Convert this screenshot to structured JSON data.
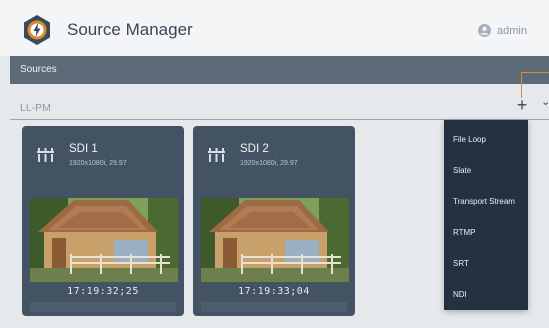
{
  "header": {
    "title": "Source Manager",
    "user": "admin",
    "logo_icon": "gear-lightning-logo-icon",
    "user_icon": "user-circle-icon"
  },
  "sources_bar": {
    "label": "Sources"
  },
  "group": {
    "name": "LL-PM",
    "add_label": "+",
    "add_icon": "plus-icon",
    "chevron_icon": "chevron-down-icon"
  },
  "cards": [
    {
      "name": "SDI 1",
      "format": "1920x1080i, 29.97",
      "timecode": "17:19:32;25",
      "icon": "sdi-connector-icon"
    },
    {
      "name": "SDI 2",
      "format": "1920x1080i, 29.97",
      "timecode": "17:19:33;04",
      "icon": "sdi-connector-icon"
    }
  ],
  "menu": {
    "items": [
      {
        "label": "File Loop"
      },
      {
        "label": "Slate"
      },
      {
        "label": "Transport Stream"
      },
      {
        "label": "RTMP"
      },
      {
        "label": "SRT"
      },
      {
        "label": "NDI"
      }
    ]
  },
  "colors": {
    "header_bg": "#f4f5f7",
    "sources_bar": "#5d6a78",
    "card_bg": "#435363",
    "menu_bg": "#243140",
    "accent": "#e08a2d"
  }
}
